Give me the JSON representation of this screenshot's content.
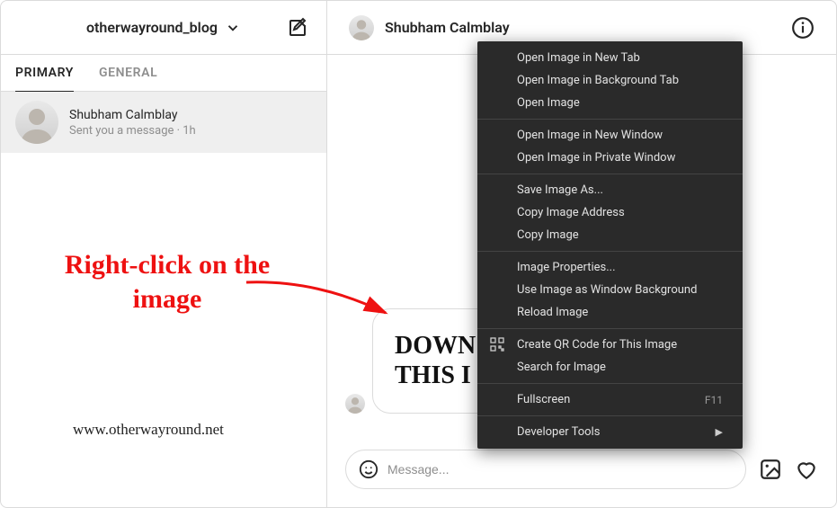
{
  "sidebar": {
    "account_name": "otherwayround_blog",
    "tabs": {
      "primary": "PRIMARY",
      "general": "GENERAL"
    },
    "thread": {
      "name": "Shubham Calmblay",
      "subtitle": "Sent you a message · 1h"
    }
  },
  "conversation": {
    "header_name": "Shubham Calmblay",
    "message_text_line1": "DOWN",
    "message_text_line2": "THIS I",
    "composer_placeholder": "Message..."
  },
  "context_menu": {
    "items": [
      "Open Image in New Tab",
      "Open Image in Background Tab",
      "Open Image",
      "Open Image in New Window",
      "Open Image in Private Window",
      "Save Image As...",
      "Copy Image Address",
      "Copy Image",
      "Image Properties...",
      "Use Image as Window Background",
      "Reload Image",
      "Create QR Code for This Image",
      "Search for Image",
      "Fullscreen",
      "Developer Tools"
    ],
    "fullscreen_shortcut": "F11"
  },
  "annotations": {
    "instruction": "Right-click on the image",
    "watermark": "www.otherwayround.net"
  }
}
